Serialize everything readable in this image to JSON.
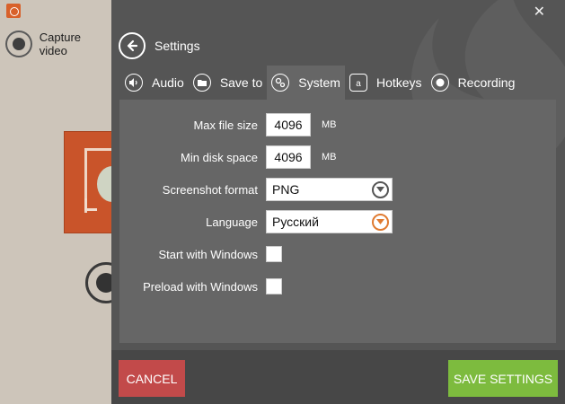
{
  "background_app": {
    "capture_label": "Capture video"
  },
  "settings": {
    "title": "Settings",
    "tabs": [
      {
        "label": "Audio",
        "icon": "speaker-icon"
      },
      {
        "label": "Save to",
        "icon": "folder-icon"
      },
      {
        "label": "System",
        "icon": "gears-icon"
      },
      {
        "label": "Hotkeys",
        "icon": "key-a-icon"
      },
      {
        "label": "Recording",
        "icon": "record-icon"
      }
    ],
    "active_tab": "System",
    "fields": {
      "max_file_size": {
        "label": "Max file size",
        "value": "4096",
        "unit": "MB"
      },
      "min_disk_space": {
        "label": "Min disk space",
        "value": "4096",
        "unit": "MB"
      },
      "screenshot_format": {
        "label": "Screenshot format",
        "value": "PNG"
      },
      "language": {
        "label": "Language",
        "value": "Русский"
      },
      "start_with_windows": {
        "label": "Start with Windows",
        "checked": false
      },
      "preload_with_windows": {
        "label": "Preload with Windows",
        "checked": false
      }
    },
    "buttons": {
      "cancel": "CANCEL",
      "save": "SAVE SETTINGS"
    }
  },
  "colors": {
    "panel_bg": "#555555",
    "content_bg": "#666666",
    "footer_bg": "#474747",
    "cancel": "#c24a4a",
    "save": "#7dbb3e",
    "accent_orange": "#e07a30"
  }
}
